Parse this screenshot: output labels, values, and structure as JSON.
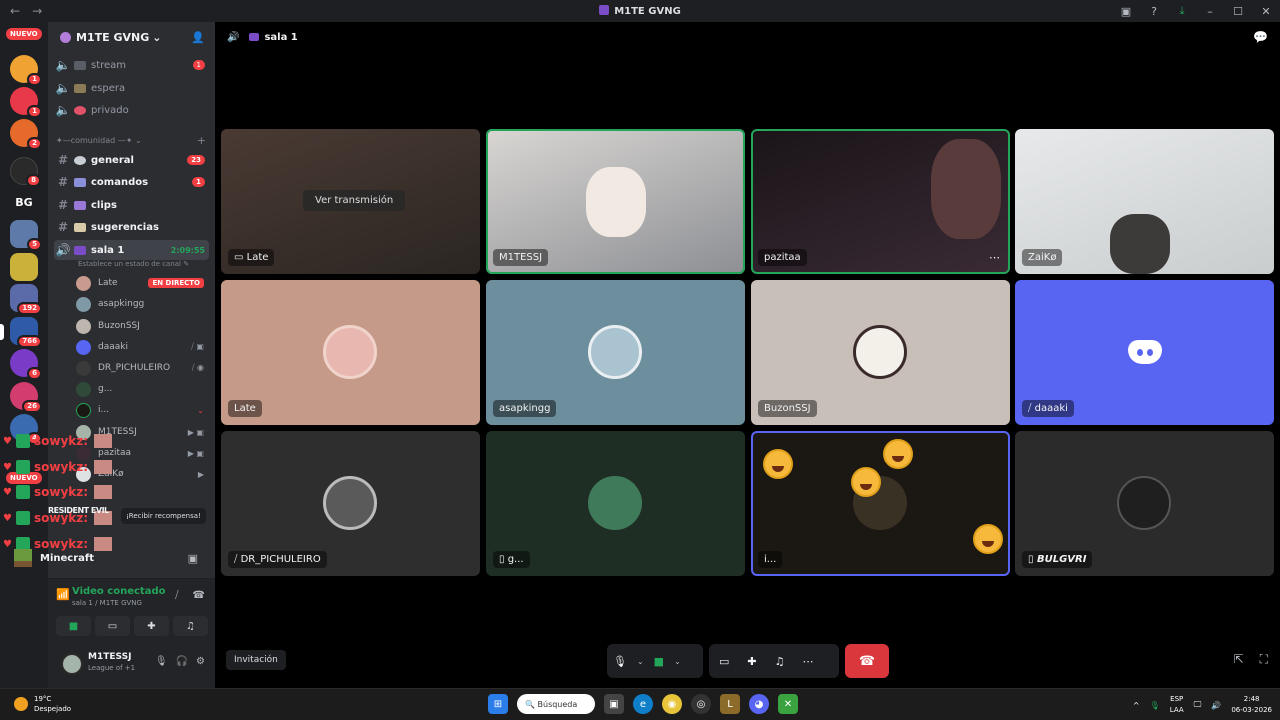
{
  "titlebar": {
    "title": "M1TE GVNG",
    "back": "←",
    "forward": "→",
    "inbox": "▣",
    "help": "?",
    "download": "⤓",
    "minimize": "–",
    "maximize": "☐",
    "close": "✕"
  },
  "rail": {
    "nuevo_top": "NUEVO",
    "nuevo_bottom": "NUEVO",
    "badges": {
      "b1": "1",
      "b2": "1",
      "b3": "2",
      "b4": "8",
      "b5": "5",
      "b6": "192",
      "b7": "766",
      "b8": "6",
      "b9": "26",
      "b10": "4"
    },
    "bg_label": "BG"
  },
  "guild": {
    "name": "M1TE GVNG",
    "chevron": "⌄",
    "add_user": "👤"
  },
  "channels_top": [
    {
      "name": "stream",
      "badge": "1"
    },
    {
      "name": "espera"
    },
    {
      "name": "privado"
    }
  ],
  "category": {
    "label": "✦—comunidad —✦ ⌄",
    "plus": "+"
  },
  "text_channels": [
    {
      "name": "general",
      "badge": "23"
    },
    {
      "name": "comandos",
      "badge": "1"
    },
    {
      "name": "clips"
    },
    {
      "name": "sugerencias"
    }
  ],
  "voice_channel": {
    "name": "sala 1",
    "time": "2:09:55",
    "status": "Establece un estado de canal ✎"
  },
  "voice_users": [
    {
      "name": "Late",
      "live": "EN DIRECTO"
    },
    {
      "name": "asapkingg"
    },
    {
      "name": "BuzonSSJ"
    },
    {
      "name": "daaaki",
      "icons": "⧸ ▣"
    },
    {
      "name": "DR_PICHULEIRO",
      "icons": "⧸ ◉"
    },
    {
      "name": "g..."
    },
    {
      "name": "i...",
      "icons": "⌄"
    },
    {
      "name": "M1TESSJ",
      "icons": "▶ ▣"
    },
    {
      "name": "pazitaa",
      "icons": "▶ ▣"
    },
    {
      "name": "ZaiKø",
      "icons": "▶"
    }
  ],
  "overlay": {
    "user": "sowykz",
    "reward": "¡Recibir recompensa!",
    "game_logo": "RESIDENT EVIL"
  },
  "minecraft": {
    "label": "Minecraft",
    "icon": "▣"
  },
  "voice_panel": {
    "title": "Video conectado",
    "sub": "sala 1 / M1TE GVNG",
    "signal": "📶",
    "noise": "⧸",
    "disconnect": "☎",
    "btn_camera": "■",
    "btn_screen": "▭",
    "btn_activity": "✚",
    "btn_soundboard": "♫"
  },
  "user_panel": {
    "name": "M1TESSJ",
    "status": "League of  +1",
    "mic": "🎙",
    "headset": "🎧",
    "settings": "⚙"
  },
  "stage": {
    "speaker": "🔊",
    "channel": "sala 1",
    "chat_icon": "💬"
  },
  "tiles": [
    {
      "label": "Late",
      "overlay_text": "Ver transmisión",
      "colors": [
        "#4a3a33",
        "#2b2622"
      ]
    },
    {
      "label": "M1TESSJ",
      "colors": [
        "#d9d6d3",
        "#8d8f94"
      ]
    },
    {
      "label": "pazitaa",
      "colors": [
        "#1a1418",
        "#3a2b35"
      ]
    },
    {
      "label": "ZaiKø",
      "colors": [
        "#e7e9ea",
        "#c9cdce"
      ]
    },
    {
      "label": "Late",
      "colors": [
        "#c69a88",
        "#c69a88"
      ]
    },
    {
      "label": "asapkingg",
      "colors": [
        "#6d8e9c",
        "#6d8e9c"
      ]
    },
    {
      "label": "BuzonSSJ",
      "colors": [
        "#c8c0b8",
        "#c8c0b8"
      ]
    },
    {
      "label": "daaaki",
      "colors": [
        "#5865f2",
        "#5865f2"
      ]
    },
    {
      "label": "DR_PICHULEIRO",
      "colors": [
        "#2e2e2e",
        "#2e2e2e"
      ]
    },
    {
      "label": "g...",
      "colors": [
        "#1f2e25",
        "#1f2e25"
      ]
    },
    {
      "label": "i...",
      "colors": [
        "#1b1813",
        "#1b1813"
      ]
    },
    {
      "label": "BULGVRI",
      "colors": [
        "#2b2b2b",
        "#2b2b2b"
      ]
    }
  ],
  "controls": {
    "invite": "Invitación",
    "mic": "🎙",
    "camera": "■",
    "screen": "▭",
    "activity": "✚",
    "soundboard": "♫",
    "more": "⋯",
    "hangup": "☎",
    "popout": "⇱",
    "fullscreen": "⛶",
    "chev": "⌄"
  },
  "taskbar": {
    "temp": "19°C",
    "weather": "Despejado",
    "search": "🔍 Búsqueda",
    "lang": "ESP",
    "region": "LAA",
    "time": "2:48",
    "date": "06-03-2026",
    "up": "^"
  },
  "colors": {
    "green": "#23a55a",
    "red": "#f23f43",
    "blurple": "#5865f2"
  }
}
